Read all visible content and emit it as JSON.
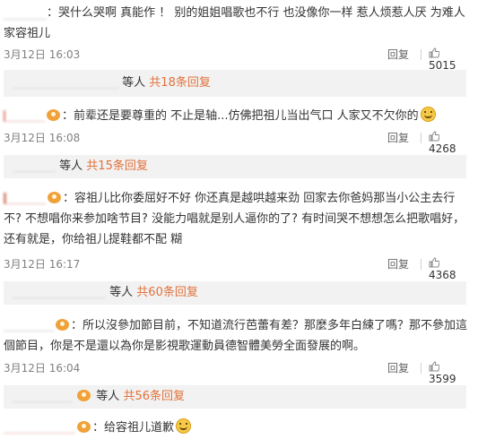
{
  "comments": [
    {
      "user": "",
      "text": "哭什么哭啊  真能作  ！  别的姐姐唱歌也不行  也没像你一样   惹人烦惹人厌    为难人家容祖儿",
      "date": "3月12日 16:03",
      "reply_label": "回复",
      "likes": "5015",
      "thread": {
        "user": "",
        "suffix": "等人",
        "count": "共18条回复"
      }
    },
    {
      "user": "",
      "text": "前辈还是要尊重的 不止是轴...仿佛把祖儿当出气口 人家又不欠你的",
      "date": "3月12日 16:08",
      "reply_label": "回复",
      "likes": "4268",
      "thread": {
        "user": "",
        "suffix": "等人",
        "count": "共15条回复"
      }
    },
    {
      "user": "",
      "text": "容祖儿比你委屈好不好 你还真是越哄越来劲 回家去你爸妈那当小公主去行不? 不想唱你来参加啥节目? 没能力唱就是别人逼你的了? 有时间哭不想想怎么把歌唱好，还有就是，你给祖儿提鞋都不配 糊",
      "date": "3月12日 16:17",
      "reply_label": "回复",
      "likes": "4368",
      "thread": {
        "user": "",
        "suffix": "等人",
        "count": "共60条回复"
      }
    },
    {
      "user": "",
      "text": "所以沒參加節目前，不知道流行芭蕾有差？那麼多年白練了嗎？那不參加這個節目，你是不是還以為你是影視歌運動員德智體美勞全面發展的啊。",
      "date": "3月12日 16:04",
      "reply_label": "回复",
      "likes": "3599",
      "thread": {
        "user": "",
        "suffix": "等人",
        "count": "共56条回复"
      }
    },
    {
      "user": "",
      "text": "给容祖儿道歉"
    }
  ],
  "colors": {
    "username": "#d16a54",
    "count": "#e2713b",
    "meta": "#808080",
    "reply_bg": "#f2f2f2"
  },
  "icons": {
    "like": "thumbs-up-icon",
    "badge": "fan-badge-icon",
    "emoji": "smile-emoji-icon"
  }
}
